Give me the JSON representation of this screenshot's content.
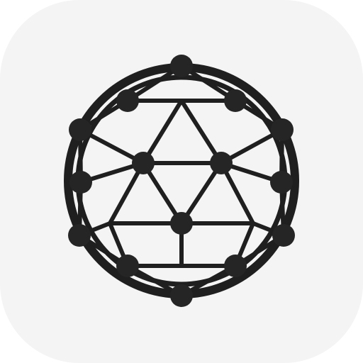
{
  "app_icon": {
    "icon": "geodesic-sphere-network-icon",
    "colors": {
      "tile": "#f4f4f4",
      "stroke": "#1f1f1f",
      "node": "#252525"
    }
  }
}
